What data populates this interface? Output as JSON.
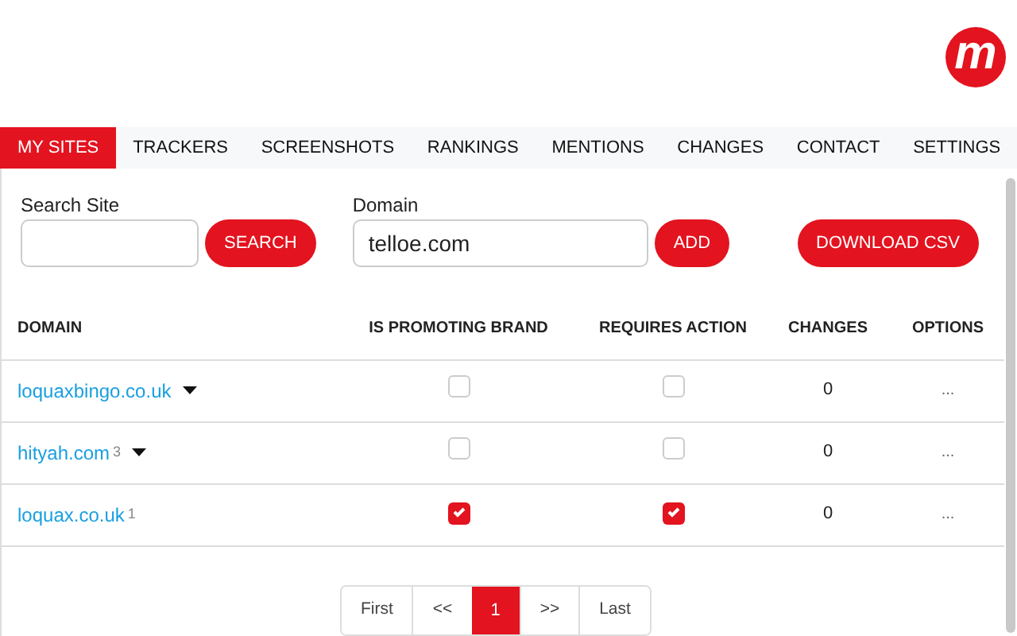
{
  "logo": {
    "text": "m"
  },
  "tabs": [
    {
      "label": "MY SITES",
      "selected": true
    },
    {
      "label": "TRACKERS",
      "selected": false
    },
    {
      "label": "SCREENSHOTS",
      "selected": false
    },
    {
      "label": "RANKINGS",
      "selected": false
    },
    {
      "label": "MENTIONS",
      "selected": false
    },
    {
      "label": "CHANGES",
      "selected": false
    },
    {
      "label": "CONTACT",
      "selected": false
    },
    {
      "label": "SETTINGS",
      "selected": false
    }
  ],
  "search": {
    "label": "Search Site",
    "button": "SEARCH"
  },
  "domain": {
    "label": "Domain",
    "value": "telloe.com",
    "button": "ADD"
  },
  "download_button": "DOWNLOAD CSV",
  "table": {
    "columns": [
      "DOMAIN",
      "IS PROMOTING BRAND",
      "REQUIRES ACTION",
      "CHANGES",
      "OPTIONS"
    ],
    "rows": [
      {
        "domain": "loquaxbingo.co.uk",
        "expandable": true,
        "promoting": false,
        "requires_action": false,
        "changes": "0",
        "options": "..."
      },
      {
        "domain": "hityah.com",
        "count": "3",
        "expandable": true,
        "promoting": false,
        "requires_action": false,
        "changes": "0",
        "options": "..."
      },
      {
        "domain": "loquax.co.uk",
        "count": "1",
        "expandable": false,
        "promoting": true,
        "requires_action": true,
        "changes": "0",
        "options": "..."
      }
    ]
  },
  "pagination": [
    {
      "label": "First",
      "selected": false
    },
    {
      "label": "<<",
      "selected": false
    },
    {
      "label": "1",
      "selected": true
    },
    {
      "label": ">>",
      "selected": false
    },
    {
      "label": "Last",
      "selected": false
    }
  ]
}
